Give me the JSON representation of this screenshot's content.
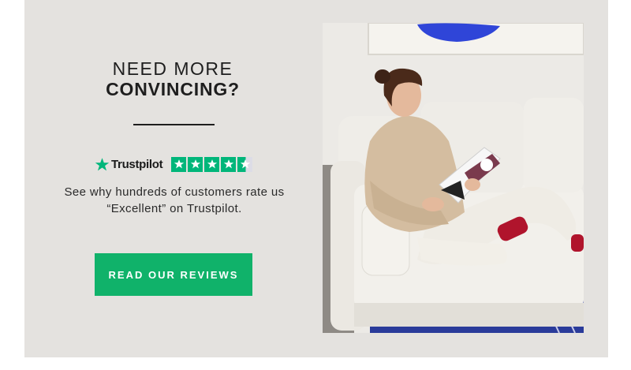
{
  "promo": {
    "heading_line1": "NEED MORE",
    "heading_line2": "CONVINCING?",
    "trustpilot_brand": "Trustpilot",
    "trustpilot_rating_stars": 4.5,
    "description_line1": "See why hundreds of customers rate us",
    "description_line2": "“Excellent” on Trustpilot.",
    "cta_label": "READ OUR REVIEWS"
  },
  "colors": {
    "card_background": "#e4e2df",
    "trustpilot_green": "#00b67a",
    "cta_background": "#10b26a",
    "heading_text": "#1e1e1e"
  },
  "icons": {
    "trustpilot_logo": "star-icon",
    "rating": "rating-star-icon"
  }
}
